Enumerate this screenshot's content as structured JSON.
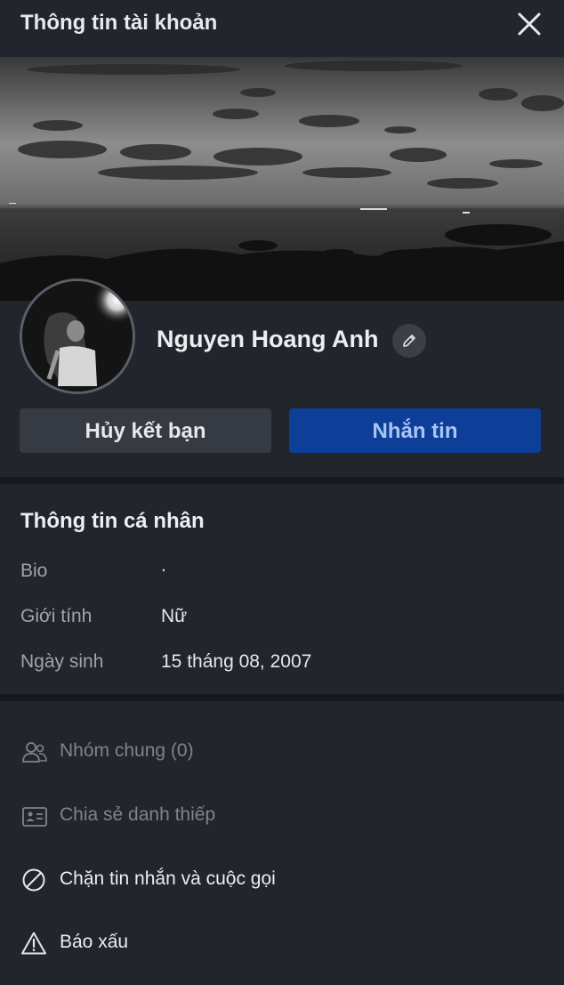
{
  "header": {
    "title": "Thông tin tài khoản"
  },
  "profile": {
    "name": "Nguyen Hoang Anh"
  },
  "actions": {
    "unfriend_label": "Hủy kết bạn",
    "message_label": "Nhắn tin"
  },
  "personal_info": {
    "title": "Thông tin cá nhân",
    "rows": [
      {
        "label": "Bio",
        "value": "."
      },
      {
        "label": "Giới tính",
        "value": "Nữ"
      },
      {
        "label": "Ngày sinh",
        "value": "15 tháng 08, 2007"
      }
    ]
  },
  "menu": {
    "items": [
      {
        "label": "Nhóm chung (0)",
        "icon": "group-icon",
        "enabled": false
      },
      {
        "label": "Chia sẻ danh thiếp",
        "icon": "contact-card-icon",
        "enabled": false
      },
      {
        "label": "Chặn tin nhắn và cuộc gọi",
        "icon": "block-icon",
        "enabled": true
      },
      {
        "label": "Báo xấu",
        "icon": "warning-icon",
        "enabled": true
      }
    ]
  },
  "colors": {
    "background": "#22252c",
    "primary_button": "#0d3f98",
    "primary_button_text": "#a9c5f5",
    "divider": "#161920"
  }
}
